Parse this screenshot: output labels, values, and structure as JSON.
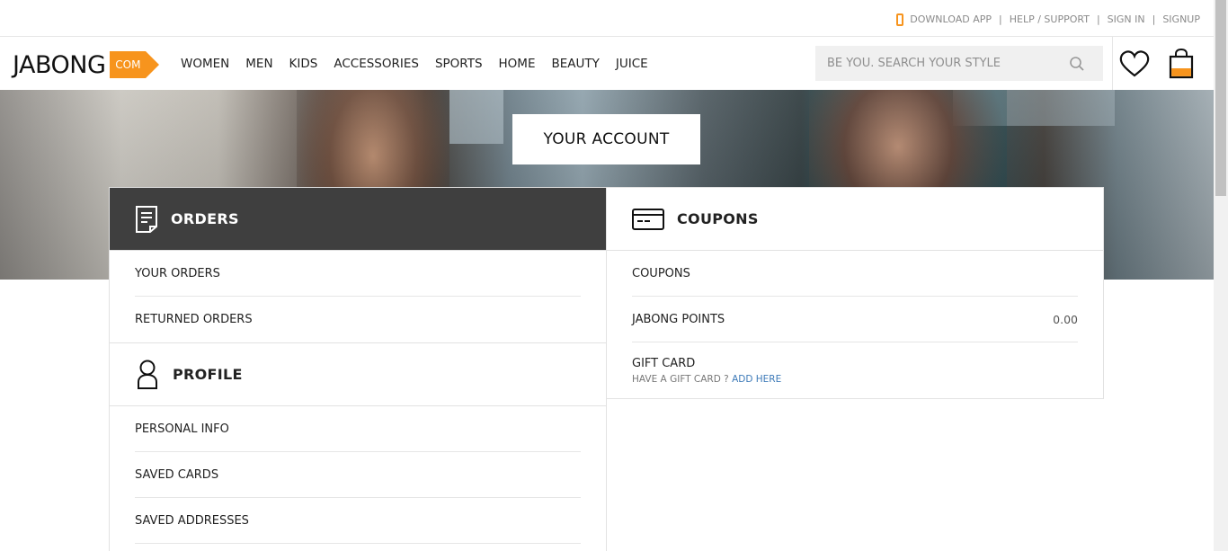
{
  "topbar": {
    "download_app": "DOWNLOAD APP",
    "help_support": "HELP / SUPPORT",
    "sign_in": "SIGN IN",
    "signup": "SIGNUP",
    "separator": "|"
  },
  "header": {
    "logo_word": "JABONG",
    "logo_com": "COM",
    "nav": [
      "WOMEN",
      "MEN",
      "KIDS",
      "ACCESSORIES",
      "SPORTS",
      "HOME",
      "BEAUTY",
      "JUICE"
    ],
    "search_placeholder": "BE YOU. SEARCH YOUR STYLE",
    "accent_color": "#f7941d"
  },
  "hero": {
    "title": "YOUR ACCOUNT"
  },
  "orders": {
    "title": "ORDERS",
    "items": [
      "YOUR ORDERS",
      "RETURNED ORDERS"
    ]
  },
  "profile": {
    "title": "PROFILE",
    "items": [
      "PERSONAL INFO",
      "SAVED CARDS",
      "SAVED ADDRESSES"
    ]
  },
  "coupons": {
    "title": "COUPONS",
    "items": {
      "coupons": "COUPONS",
      "points_label": "JABONG POINTS",
      "points_value": "0.00",
      "gift_card": "GIFT CARD",
      "gift_card_prompt": "HAVE A GIFT CARD ?",
      "gift_card_link": "ADD HERE"
    }
  },
  "icons": {
    "phone": "phone-icon",
    "search": "search-icon",
    "wishlist": "heart-icon",
    "cart": "bag-icon",
    "orders": "document-icon",
    "profile": "person-icon",
    "coupons": "card-icon"
  }
}
